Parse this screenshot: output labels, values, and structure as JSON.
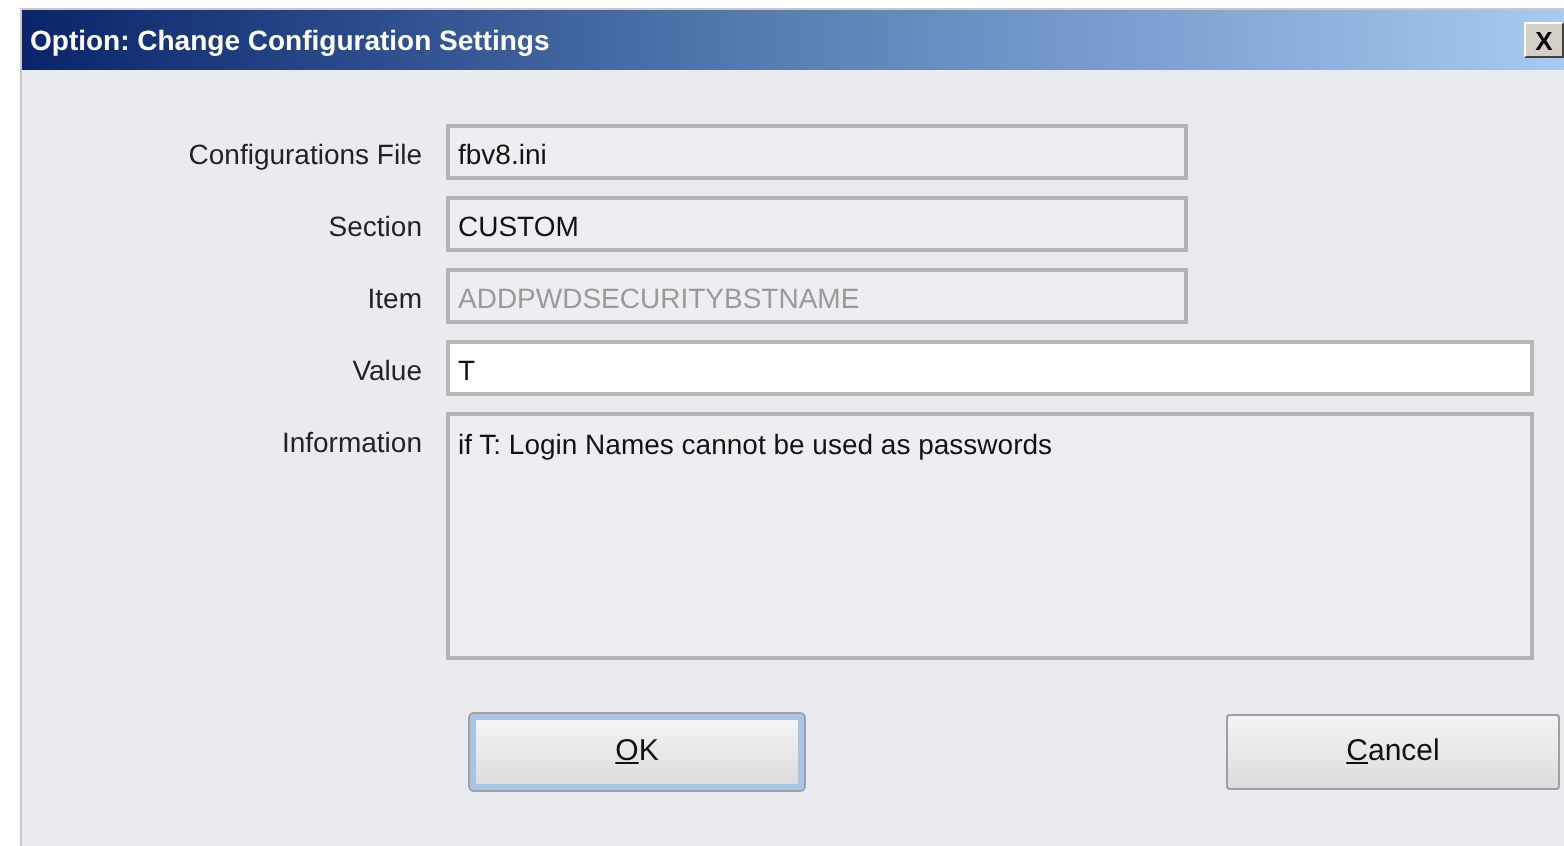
{
  "window": {
    "title": "Option: Change Configuration Settings",
    "close_label": "X"
  },
  "fields": [
    {
      "label": "Configurations File",
      "value": "fbv8.ini",
      "kind": "readonly",
      "disabled": false
    },
    {
      "label": "Section",
      "value": "CUSTOM",
      "kind": "readonly",
      "disabled": false
    },
    {
      "label": "Item",
      "value": "ADDPWDSECURITYBSTNAME",
      "kind": "readonly",
      "disabled": true
    },
    {
      "label": "Value",
      "value": "T",
      "kind": "editable",
      "disabled": false
    },
    {
      "label": "Information",
      "value": "if T: Login Names cannot be used as passwords",
      "kind": "memo",
      "disabled": false
    }
  ],
  "buttons": [
    {
      "label": "OK",
      "focused": true
    },
    {
      "label": "Cancel",
      "focused": false
    }
  ]
}
